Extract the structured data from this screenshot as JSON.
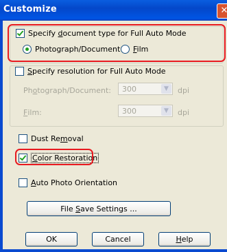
{
  "window": {
    "title": "Customize",
    "close_glyph": "✕"
  },
  "doc_type": {
    "checkbox": {
      "label_pre": "Specify ",
      "label_ul": "d",
      "label_post": "ocument type for Full Auto Mode",
      "checked": true
    },
    "options": [
      {
        "label": "Photograph/Document",
        "selected": true
      },
      {
        "label_ul": "F",
        "label_post": "ilm",
        "selected": false
      }
    ]
  },
  "resolution": {
    "checkbox": {
      "label_pre": "",
      "label_ul": "S",
      "label_post": "pecify resolution for Full Auto Mode",
      "checked": false
    },
    "rows": [
      {
        "label_pre": "Ph",
        "label_ul": "o",
        "label_post": "tograph/Document:",
        "value": "300",
        "unit": "dpi"
      },
      {
        "label_pre": "",
        "label_ul": "F",
        "label_post": "ilm:",
        "value": "300",
        "unit": "dpi"
      }
    ]
  },
  "dust_removal": {
    "label_pre": "Dust Re",
    "label_ul": "m",
    "label_post": "oval",
    "checked": false
  },
  "color_restoration": {
    "label_pre": "",
    "label_ul": "C",
    "label_post": "olor Restoration",
    "checked": true
  },
  "auto_orientation": {
    "label_pre": "",
    "label_ul": "A",
    "label_post": "uto Photo Orientation",
    "checked": false
  },
  "buttons": {
    "file_save": {
      "pre": "File ",
      "ul": "S",
      "post": "ave Settings ..."
    },
    "ok": "OK",
    "cancel": "Cancel",
    "help": {
      "ul": "H",
      "post": "elp"
    }
  },
  "colors": {
    "highlight": "#e8191f",
    "titlebar": "#0a5ee0",
    "face": "#ece9d8"
  },
  "icons": {
    "check": "checkmark-icon",
    "radio": "radio-dot-icon",
    "dropdown": "chevron-down-icon"
  }
}
